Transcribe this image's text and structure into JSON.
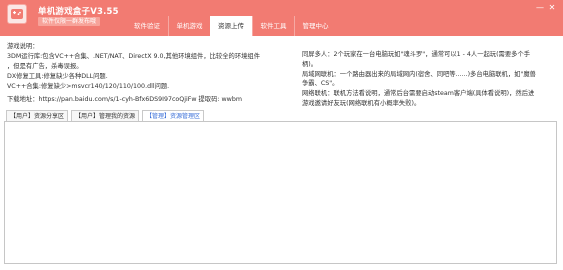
{
  "app": {
    "title": "单机游戏盒子V3.55",
    "badge": "软件仅限一群发布哦"
  },
  "tabs": [
    {
      "label": "软件验证",
      "active": false
    },
    {
      "label": "单机游戏",
      "active": false
    },
    {
      "label": "资源上传",
      "active": true
    },
    {
      "label": "软件工具",
      "active": false
    },
    {
      "label": "管理中心",
      "active": false
    }
  ],
  "window_controls": {
    "minimize": "—",
    "close": "✕"
  },
  "info": {
    "left": [
      "游戏说明：",
      "3DM运行库:包含VC++合集、.NET/NAT、DirectX 9.0,其他环境组件，比较全的环境组件",
      "，但是有广告，杀毒误报。",
      "DX修复工具:修复缺少各种DLL问题.",
      "VC++合集:修复缺少>msvcr140/120/110/100.dll问题."
    ],
    "right": [
      "同屏多人：2个玩家在一台电脑玩如\"魂斗罗\"，通常可以1 - 4人一起玩(需要多个手",
      "柄)。",
      "局域网联机：一个路由器出来的局域网内(宿舍、同吧等......)多台电脑联机，如\"魔兽",
      "争霸、CS\"。",
      "网络联机：联机方法看说明，通常后台需要启动steam客户端(具体看说明)，然后进",
      "游戏邀请好友玩(网络联机有小概率失败)。"
    ]
  },
  "download": {
    "label": "下载地址：https://pan.baidu.com/s/1-cyh-Bfx6DS9I97coQjiFw 提取码: wwbm"
  },
  "subtabs": [
    {
      "label": "【用户】资源分享区",
      "active": false
    },
    {
      "label": "【用户】管理我的资源",
      "active": false
    },
    {
      "label": "【管理】资源管理区",
      "active": true
    }
  ],
  "colors": {
    "titlebar": "#f27b72",
    "accent": "#3a6fd8"
  }
}
